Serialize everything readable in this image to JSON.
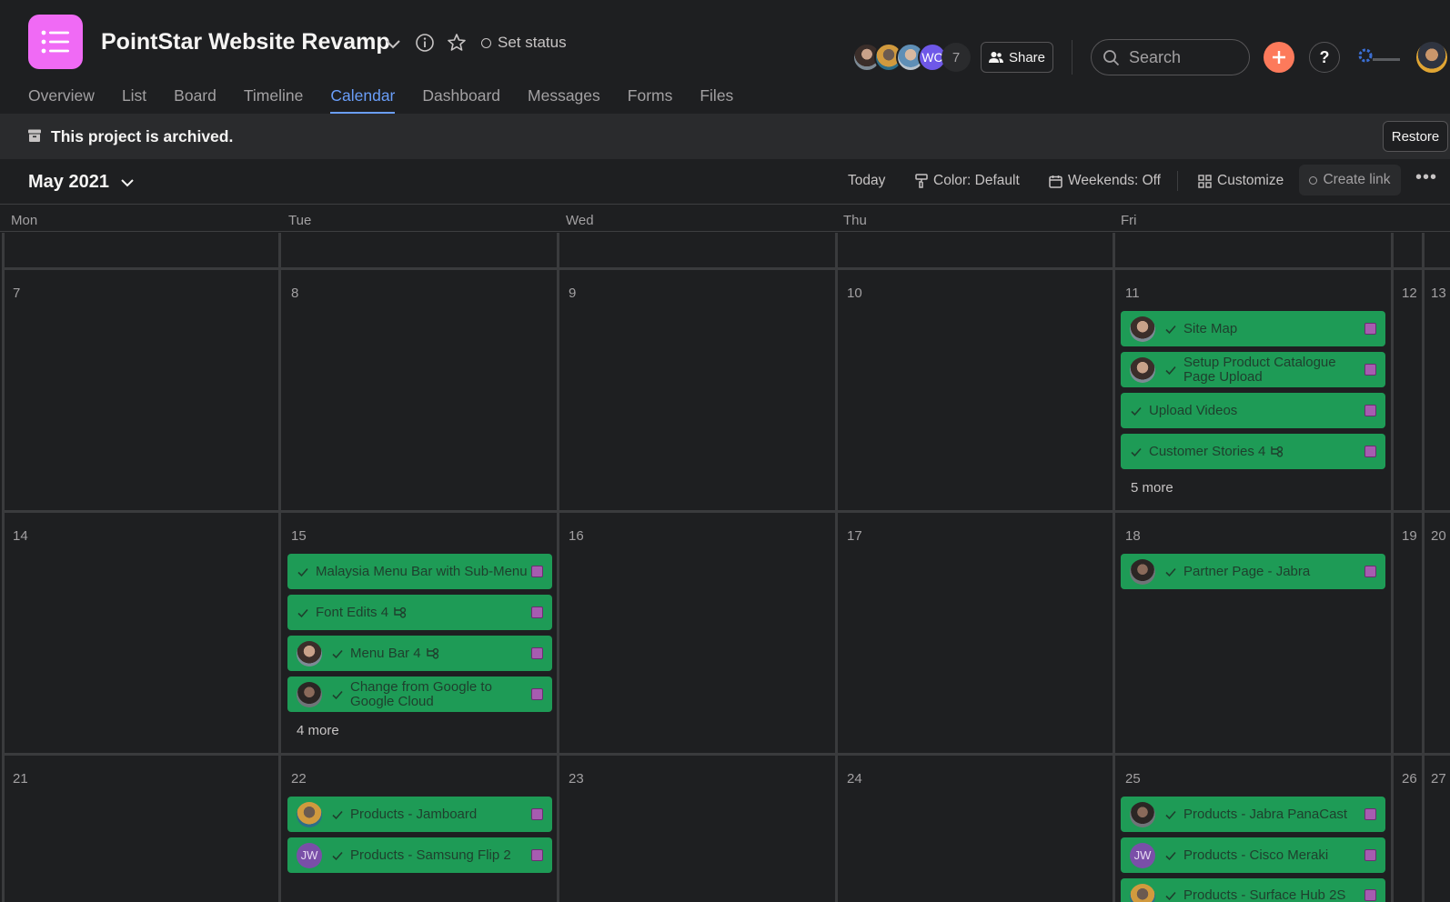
{
  "project": {
    "title": "PointStar Website Revamp",
    "set_status": "Set status"
  },
  "members": {
    "extra_count": "7",
    "initials_avatar": "WC"
  },
  "header": {
    "share_label": "Share",
    "search_placeholder": "Search",
    "help_label": "?"
  },
  "tabs": [
    {
      "label": "Overview"
    },
    {
      "label": "List"
    },
    {
      "label": "Board"
    },
    {
      "label": "Timeline"
    },
    {
      "label": "Calendar",
      "active": true
    },
    {
      "label": "Dashboard"
    },
    {
      "label": "Messages"
    },
    {
      "label": "Forms"
    },
    {
      "label": "Files"
    }
  ],
  "banner": {
    "text": "This project is archived.",
    "restore_label": "Restore"
  },
  "toolbar": {
    "month": "May 2021",
    "today": "Today",
    "color": "Color: Default",
    "weekends": "Weekends: Off",
    "customize": "Customize",
    "create_link": "Create link"
  },
  "weekdays": [
    "Mon",
    "Tue",
    "Wed",
    "Thu",
    "Fri"
  ],
  "weeks": [
    {
      "days": [
        "7",
        "8",
        "9",
        "10",
        "11",
        "12",
        "13"
      ],
      "tasks": {
        "fri": [
          {
            "name": "Site Map",
            "avatar": "photo"
          },
          {
            "name": "Setup Product Catalogue Page Upload",
            "avatar": "photo"
          },
          {
            "name": "Upload Videos"
          },
          {
            "name": "Customer Stories 4",
            "subtasks": true
          }
        ]
      },
      "more": {
        "fri": "5 more"
      }
    },
    {
      "days": [
        "14",
        "15",
        "16",
        "17",
        "18",
        "19",
        "20"
      ],
      "tasks": {
        "tue": [
          {
            "name": "Malaysia Menu Bar with Sub-Menu"
          },
          {
            "name": "Font Edits 4",
            "subtasks": true
          },
          {
            "name": "Menu Bar 4",
            "avatar": "photo",
            "subtasks": true
          },
          {
            "name": "Change from Google to Google Cloud",
            "avatar": "photo"
          }
        ],
        "fri": [
          {
            "name": "Partner Page - Jabra",
            "avatar": "photo"
          }
        ]
      },
      "more": {
        "tue": "4 more"
      }
    },
    {
      "days": [
        "21",
        "22",
        "23",
        "24",
        "25",
        "26",
        "27"
      ],
      "tasks": {
        "tue": [
          {
            "name": "Products - Jamboard",
            "avatar": "photo"
          },
          {
            "name": "Products - Samsung Flip 2",
            "avatar": "JW"
          }
        ],
        "fri": [
          {
            "name": "Products - Jabra PanaCast",
            "avatar": "photo"
          },
          {
            "name": "Products - Cisco Meraki",
            "avatar": "JW"
          },
          {
            "name": "Products - Surface Hub 2S",
            "avatar": "photo"
          }
        ]
      }
    }
  ],
  "colors": {
    "background": "#1e1f21",
    "task_green": "#1e9b56",
    "accent_blue": "#6a9ef9",
    "project_icon": "#f06af5",
    "plus_button": "#fd7a5b",
    "custom_field_square": "#a65cb0"
  }
}
